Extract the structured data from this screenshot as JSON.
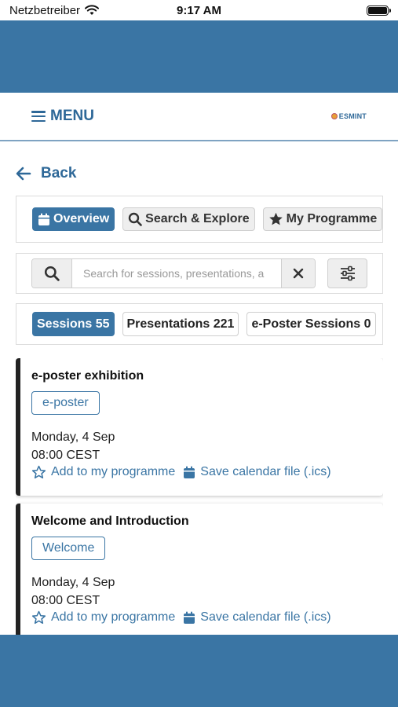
{
  "status_bar": {
    "carrier": "Netzbetreiber",
    "time": "9:17 AM"
  },
  "header": {
    "menu_label": "MENU",
    "logo_text": "ESMINT"
  },
  "back_label": "Back",
  "tabs": [
    {
      "label": "Overview",
      "icon": "calendar-icon",
      "active": true
    },
    {
      "label": "Search & Explore",
      "icon": "search-icon",
      "active": false
    },
    {
      "label": "My Programme",
      "icon": "star-icon",
      "active": false
    }
  ],
  "search": {
    "placeholder": "Search for sessions, presentations, a",
    "value": ""
  },
  "type_tabs": [
    {
      "label": "Sessions 55",
      "active": true
    },
    {
      "label": "Presentations 221",
      "active": false
    },
    {
      "label": "e-Poster Sessions 0",
      "active": false
    }
  ],
  "sessions": [
    {
      "title": "e-poster exhibition",
      "tag": "e-poster",
      "date": "Monday, 4 Sep",
      "time": "08:00 CEST",
      "add_label": "Add to my programme",
      "calendar_label": "Save calendar file (.ics)"
    },
    {
      "title": "Welcome and Introduction",
      "tag": "Welcome",
      "date": "Monday, 4 Sep",
      "time": "08:00 CEST",
      "add_label": "Add to my programme",
      "calendar_label": "Save calendar file (.ics)"
    }
  ],
  "colors": {
    "primary": "#3a75a4",
    "accent_text": "#2e6898",
    "card_border": "#222222"
  }
}
